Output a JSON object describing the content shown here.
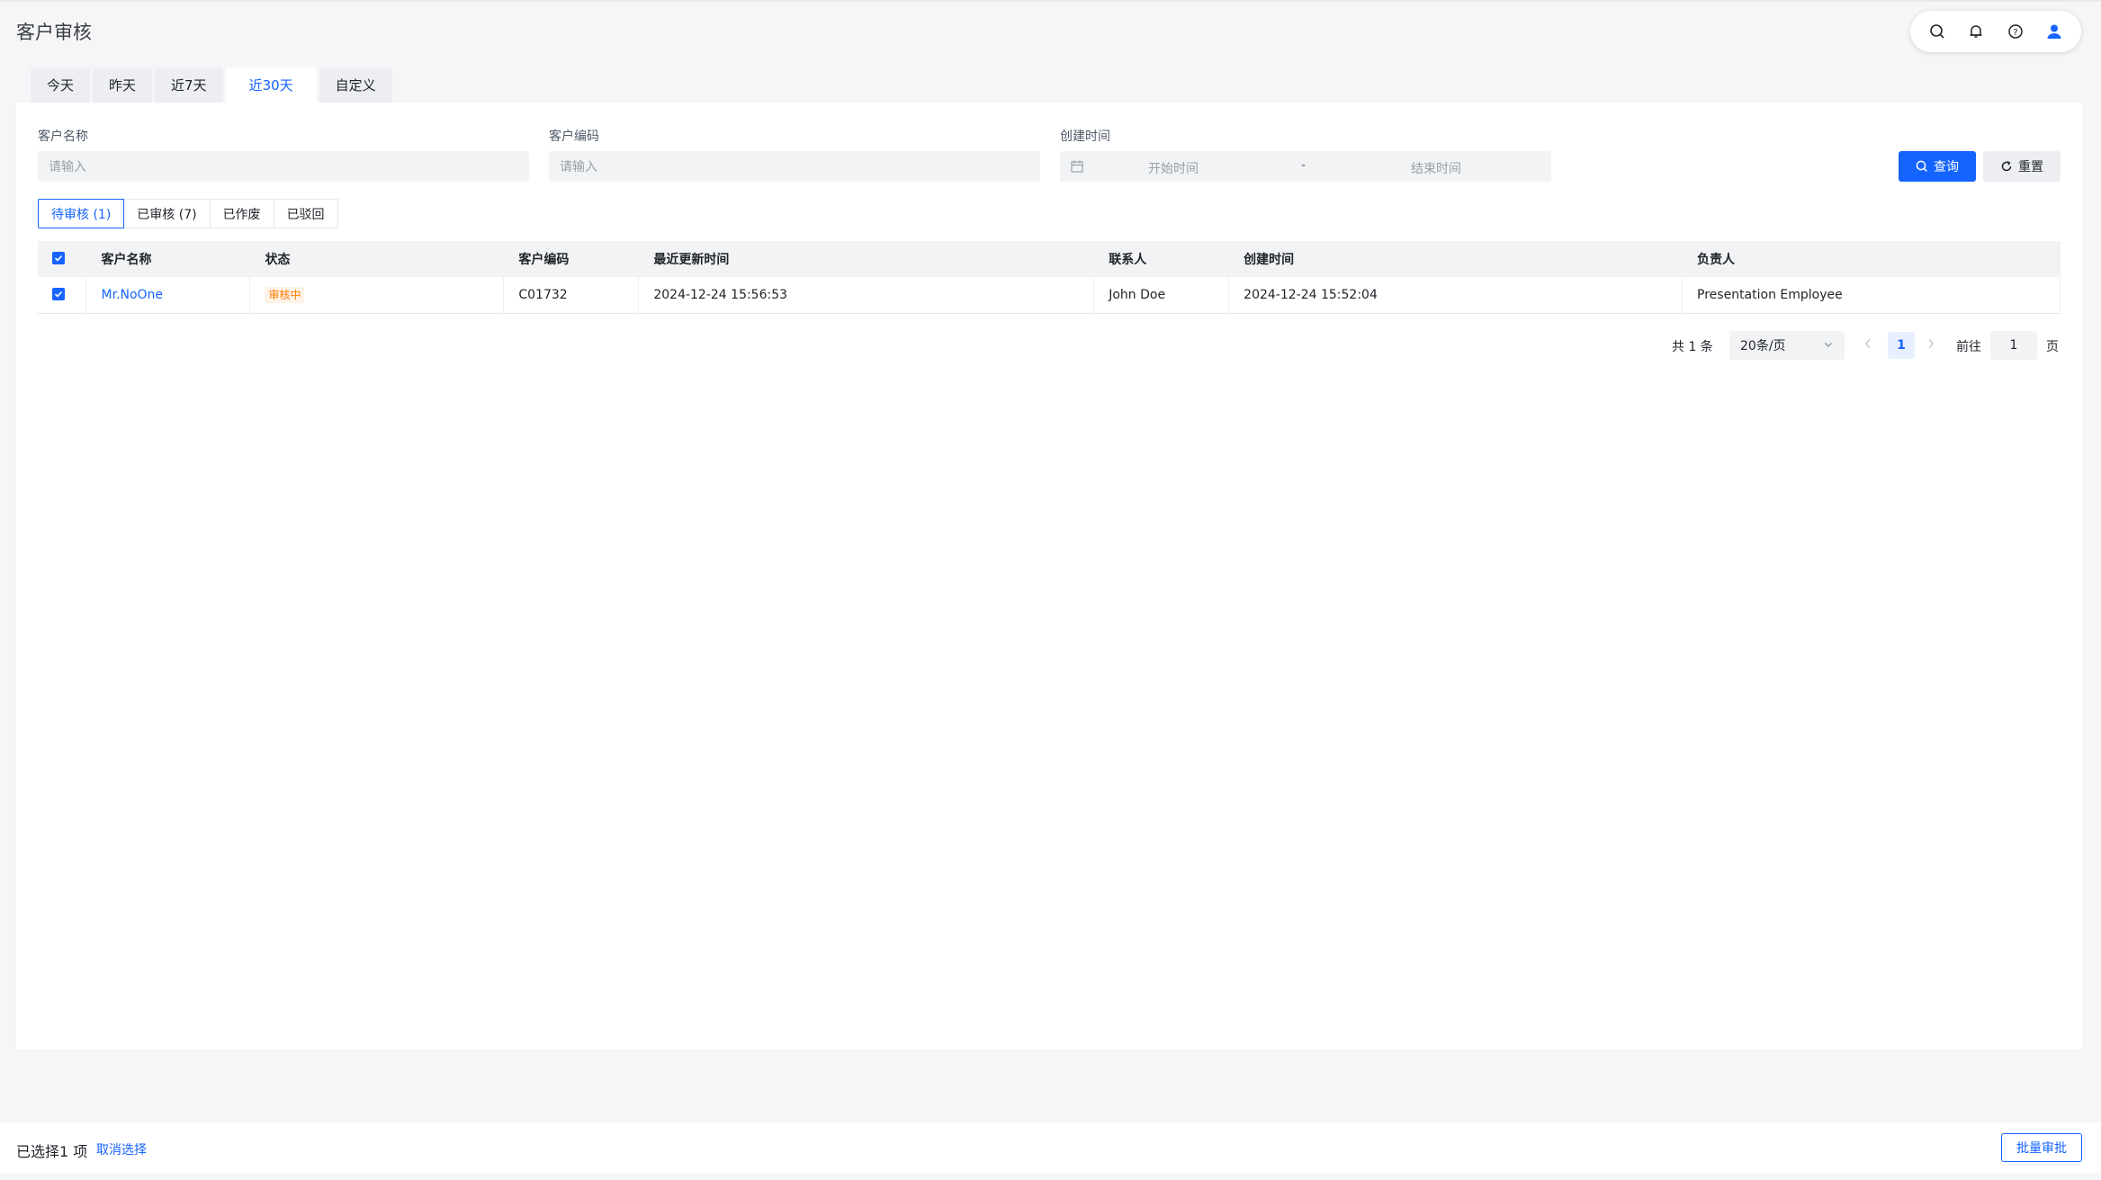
{
  "header": {
    "title": "客户审核"
  },
  "top_icons": [
    "search-icon",
    "bell-icon",
    "help-icon",
    "user-icon"
  ],
  "date_tabs": [
    "今天",
    "昨天",
    "近7天",
    "近30天",
    "自定义"
  ],
  "active_date_tab": "近30天",
  "filters": {
    "customer_name": {
      "label": "客户名称",
      "placeholder": "请输入"
    },
    "customer_code": {
      "label": "客户编码",
      "placeholder": "请输入"
    },
    "created_time": {
      "label": "创建时间",
      "start_placeholder": "开始时间",
      "separator": "-",
      "end_placeholder": "结束时间"
    },
    "search_label": "查询",
    "reset_label": "重置"
  },
  "status_tabs": [
    "待审核 (1)",
    "已审核 (7)",
    "已作废",
    "已驳回"
  ],
  "table": {
    "columns": [
      "客户名称",
      "状态",
      "客户编码",
      "最近更新时间",
      "联系人",
      "创建时间",
      "负责人"
    ],
    "rows": [
      {
        "name": "Mr.NoOne",
        "status": "审核中",
        "code": "C01732",
        "updated": "2024-12-24 15:56:53",
        "contact": "John Doe",
        "created": "2024-12-24 15:52:04",
        "owner": "Presentation Employee",
        "checked": true
      }
    ]
  },
  "pagination": {
    "total_text": "共 1 条",
    "page_size": "20条/页",
    "current_page": "1",
    "goto_label": "前往",
    "goto_value": "1",
    "page_unit": "页"
  },
  "footer": {
    "selected_text": "已选择1 项",
    "cancel_label": "取消选择",
    "batch_label": "批量审批"
  },
  "colors": {
    "primary": "#1664ff",
    "status_tag": "#ff7d00"
  }
}
